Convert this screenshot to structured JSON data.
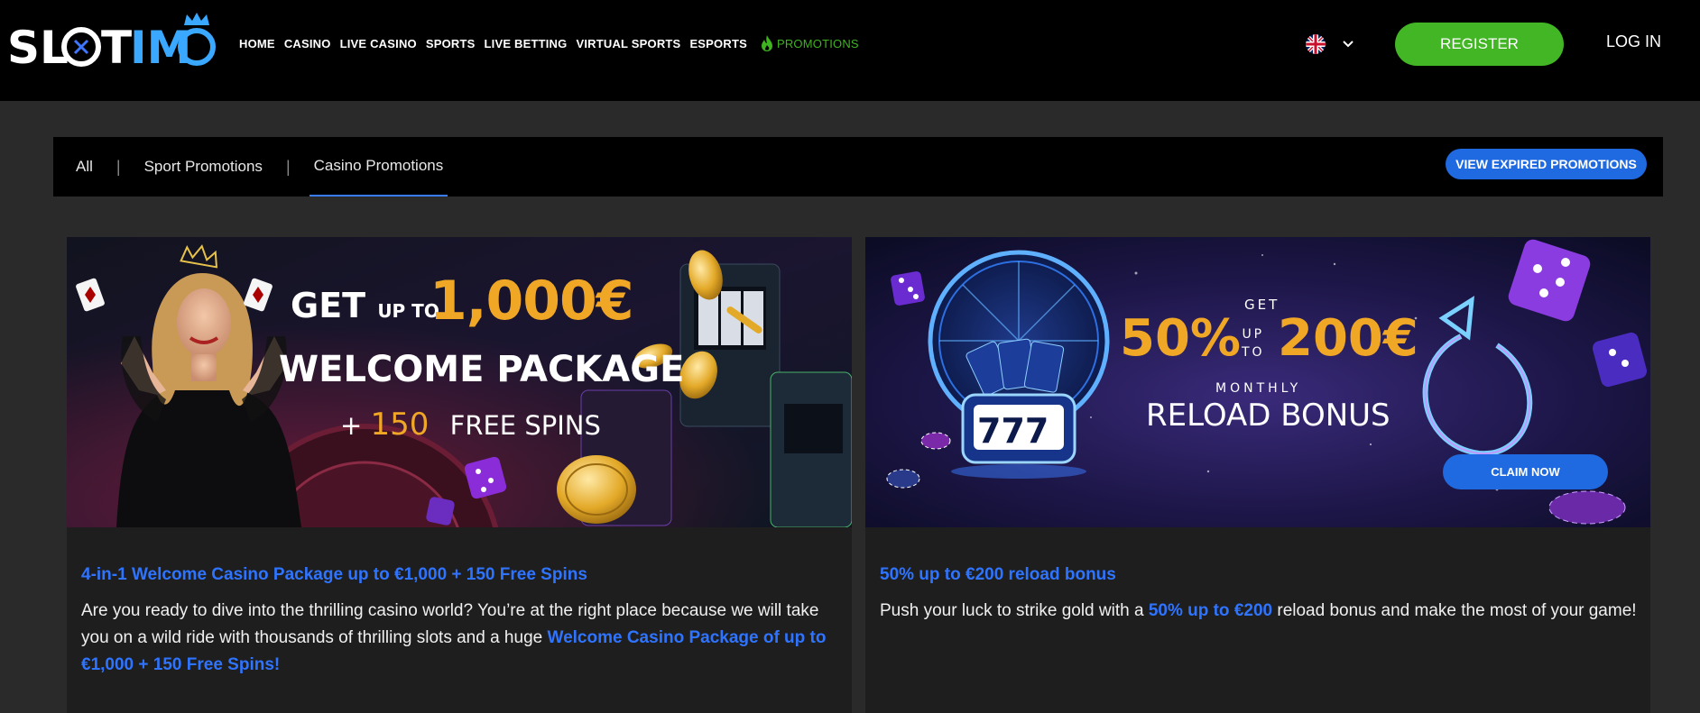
{
  "header": {
    "logo": "SLOTIMO",
    "nav": [
      {
        "label": "HOME"
      },
      {
        "label": "CASINO"
      },
      {
        "label": "LIVE CASINO"
      },
      {
        "label": "SPORTS"
      },
      {
        "label": "LIVE BETTING"
      },
      {
        "label": "VIRTUAL SPORTS"
      },
      {
        "label": "ESPORTS"
      }
    ],
    "promotions_label": "PROMOTIONS",
    "register_label": "REGISTER",
    "login_label": "LOG IN",
    "language_icon": "uk-flag-icon"
  },
  "tabs": {
    "items": [
      {
        "label": "All"
      },
      {
        "label": "Sport Promotions"
      },
      {
        "label": "Casino Promotions"
      }
    ],
    "active": "Casino Promotions",
    "separator": "|",
    "expired_label": "VIEW EXPIRED PROMOTIONS"
  },
  "cards": [
    {
      "banner": {
        "get": "GET",
        "up_to": "UP TO",
        "amount": "1,000€",
        "headline": "WELCOME PACKAGE",
        "plus": "+",
        "spins_count": "150",
        "spins_label": "FREE SPINS"
      },
      "title": "4-in-1 Welcome Casino Package up to €1,000 + 150 Free Spins",
      "body_prefix": "Are you ready to dive into the thrilling casino world? You’re at the right place because we will take you on a wild ride with thousands of thrilling slots and a huge ",
      "body_highlight": "Welcome Casino Package of up to €1,000 + 150 Free Spins!",
      "body_suffix": ""
    },
    {
      "banner": {
        "get": "GET",
        "pct": "50%",
        "up": "UP",
        "to": "TO",
        "amount": "200€",
        "monthly": "MONTHLY",
        "headline": "RELOAD BONUS",
        "claim_label": "CLAIM NOW"
      },
      "title": "50% up to €200 reload bonus",
      "body_prefix": "Push your luck to strike gold with a ",
      "body_highlight": "50% up to €200",
      "body_suffix": " reload bonus and make the most of your game!"
    }
  ],
  "colors": {
    "accent_green": "#42b624",
    "accent_blue": "#1f6ae0",
    "link_blue": "#2f74ff",
    "gold": "#f0a726"
  }
}
